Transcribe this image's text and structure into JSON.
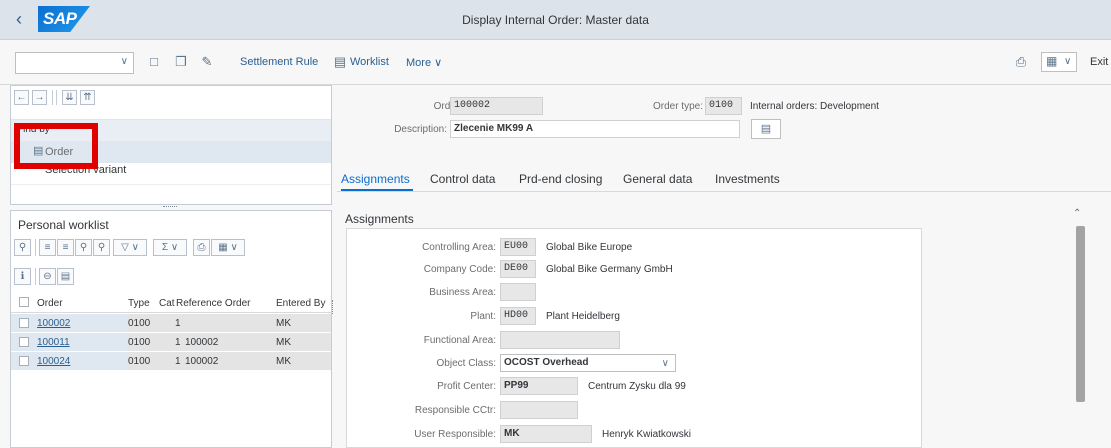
{
  "shell": {
    "title": "Display Internal Order: Master data",
    "logo_text": "SAP"
  },
  "toolbar": {
    "settlement_rule": "Settlement Rule",
    "worklist": "Worklist",
    "more": "More",
    "exit": "Exit"
  },
  "left_panel": {
    "find_by": "Find by",
    "order": "Order",
    "selection_variant": "Selection variant"
  },
  "worklist": {
    "title": "Personal worklist",
    "columns": [
      "Order",
      "Type",
      "Cat",
      "Reference Order",
      "Entered By"
    ],
    "rows": [
      {
        "order": "100002",
        "type": "0100",
        "cat": "1",
        "ref": "",
        "entered_by": "MK"
      },
      {
        "order": "100011",
        "type": "0100",
        "cat": "1",
        "ref": "100002",
        "entered_by": "MK"
      },
      {
        "order": "100024",
        "type": "0100",
        "cat": "1",
        "ref": "100002",
        "entered_by": "MK"
      }
    ]
  },
  "header": {
    "order_label": "Order:",
    "order_value": "100002",
    "order_type_label": "Order type:",
    "order_type_value": "0100",
    "order_type_text": "Internal orders: Development",
    "description_label": "Description:",
    "description_value": "Zlecenie MK99 A"
  },
  "tabs": [
    "Assignments",
    "Control data",
    "Prd-end closing",
    "General data",
    "Investments"
  ],
  "assignments": {
    "title": "Assignments",
    "controlling_area_label": "Controlling Area:",
    "controlling_area_value": "EU00",
    "controlling_area_text": "Global Bike Europe",
    "company_code_label": "Company Code:",
    "company_code_value": "DE00",
    "company_code_text": "Global Bike Germany GmbH",
    "business_area_label": "Business Area:",
    "plant_label": "Plant:",
    "plant_value": "HD00",
    "plant_text": "Plant Heidelberg",
    "functional_area_label": "Functional Area:",
    "object_class_label": "Object Class:",
    "object_class_value": "OCOST Overhead",
    "profit_center_label": "Profit Center:",
    "profit_center_value": "PP99",
    "profit_center_text": "Centrum Zysku dla 99",
    "responsible_cctr_label": "Responsible CCtr:",
    "user_responsible_label": "User Responsible:",
    "user_responsible_value": "MK",
    "user_responsible_text": "Henryk Kwiatkowski"
  },
  "colors": {
    "accent": "#0a6ed1",
    "highlight_box": "#e00000",
    "shell_bg": "#dce3ea"
  }
}
